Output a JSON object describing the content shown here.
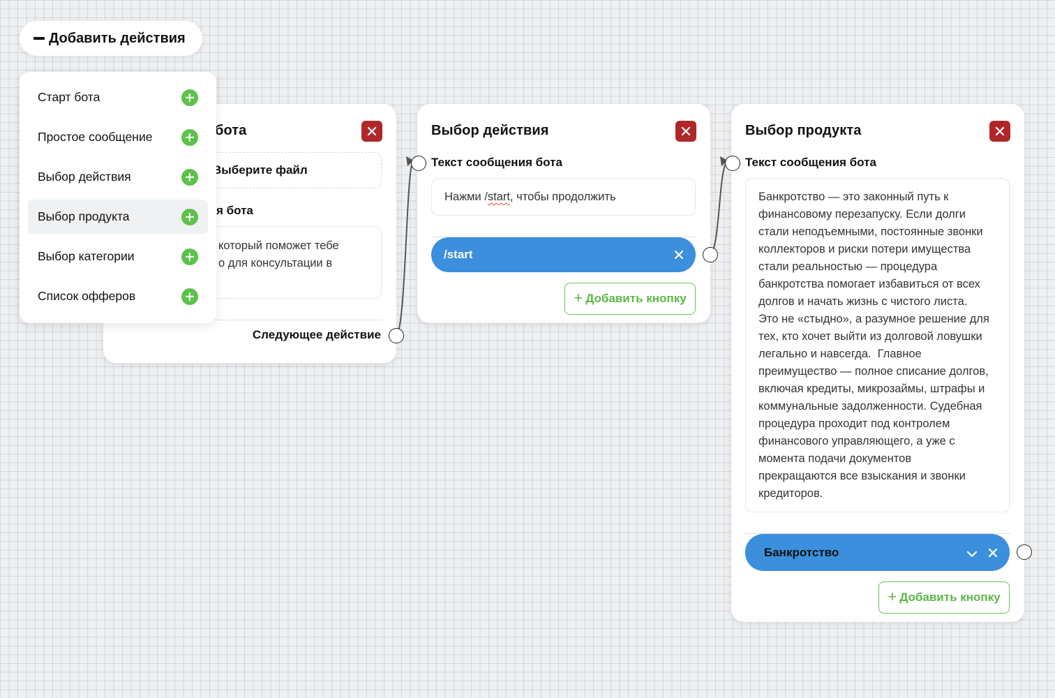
{
  "toolbar": {
    "add_actions_label": "Добавить действия"
  },
  "menu": {
    "items": [
      {
        "label": "Старт бота"
      },
      {
        "label": "Простое сообщение"
      },
      {
        "label": "Выбор действия"
      },
      {
        "label": "Выбор продукта",
        "active": true
      },
      {
        "label": "Выбор категории"
      },
      {
        "label": "Список офферов"
      }
    ]
  },
  "nodes": {
    "start": {
      "title_partial": "бота",
      "file_label_partial": "Выберите файл",
      "message_label_partial": "я бота",
      "message_text_line1_partial": "который поможет тебе",
      "message_text_line2_partial": "о для консультации в",
      "next_action_label": "Следующее действие"
    },
    "action_choice": {
      "title": "Выбор действия",
      "message_label": "Текст сообщения бота",
      "message_text_pre": "Нажми /",
      "message_text_word": "start",
      "message_text_post": ", чтобы продолжить",
      "buttons": [
        {
          "label": "/start"
        }
      ],
      "add_button_label": "Добавить кнопку"
    },
    "product_choice": {
      "title": "Выбор продукта",
      "message_label": "Текст сообщения бота",
      "message_lines": [
        "Банкротство — это законный путь к",
        "финансовому перезапуску. Если долги",
        "стали неподъемными, постоянные звонки",
        "коллекторов и риски потери имущества",
        "стали реальностью — процедура",
        "банкротства помогает избавиться от всех",
        "долгов и начать жизнь с чистого листа.",
        "Это не «стыдно», а разумное решение для",
        "тех, кто хочет выйти из долговой ловушки",
        "легально и навсегда.  Главное",
        "преимущество — полное списание долгов,",
        "включая кредиты, микрозаймы, штрафы и",
        "коммунальные задолженности. Судебная",
        "процедура проходит под контролем",
        "финансового управляющего, а уже с",
        "момента подачи документов",
        "прекращаются все взыскания и звонки",
        "кредиторов."
      ],
      "buttons": [
        {
          "label": "Банкротство"
        }
      ],
      "add_button_label": "Добавить кнопку"
    }
  },
  "colors": {
    "accent_blue": "#3b8fdc",
    "close_red": "#b0272a",
    "add_green": "#5cc24a"
  }
}
